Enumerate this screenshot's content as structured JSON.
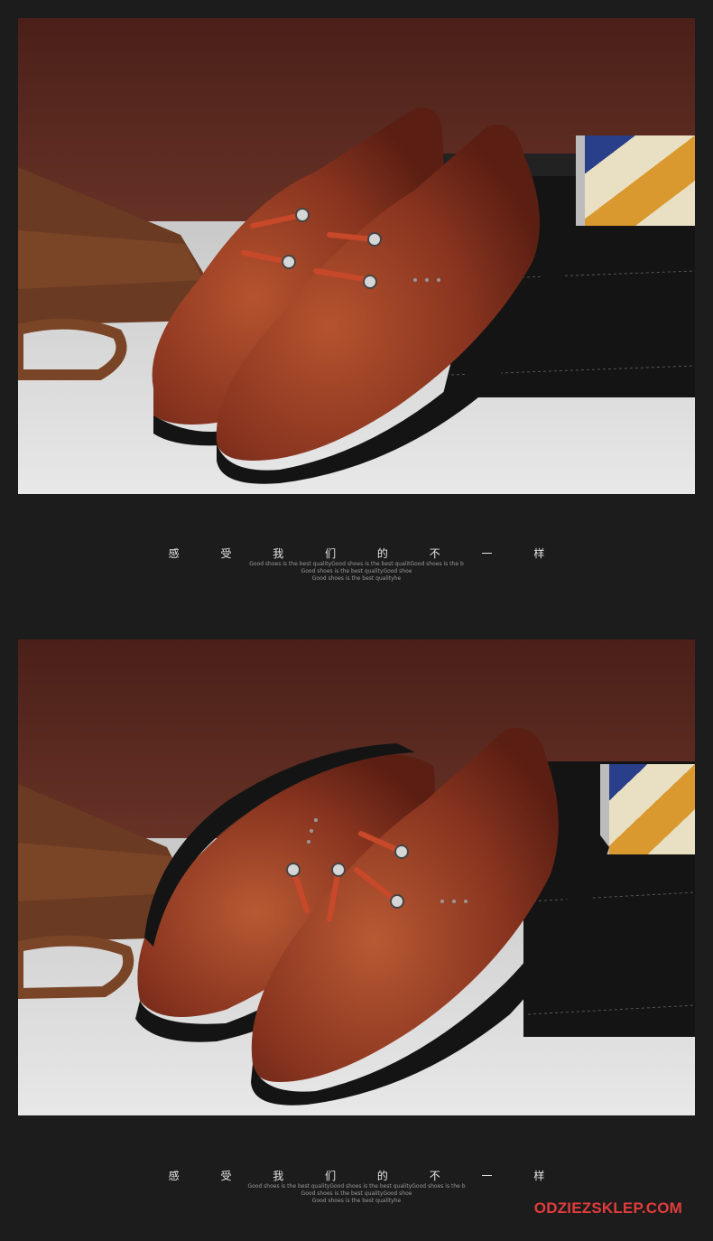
{
  "sections": [
    {
      "headline": "感 受 我 们 的 不 一 样",
      "sub_lines": [
        "Good shoes is the best qualityGood shoes is the best qualitGood shoes is the b",
        "Good shoes is the best qualityGood shoe",
        "Good shoes is the best qualityhe"
      ]
    },
    {
      "headline": "感 受 我 们 的 不 一 样",
      "sub_lines": [
        "Good shoes is the best qualityGood shoes is the best qualityGood shoes is the b",
        "Good shoes is the best qualityGood shoe",
        "Good shoes is the best qualityhe"
      ]
    }
  ],
  "watermark": "ODZIEZSKLEP.COM",
  "colors": {
    "background": "#1c1c1c",
    "wall": "#5a2a22",
    "leather": "#8e3a22",
    "sole": "#141414",
    "watermark": "#e23c3c"
  }
}
